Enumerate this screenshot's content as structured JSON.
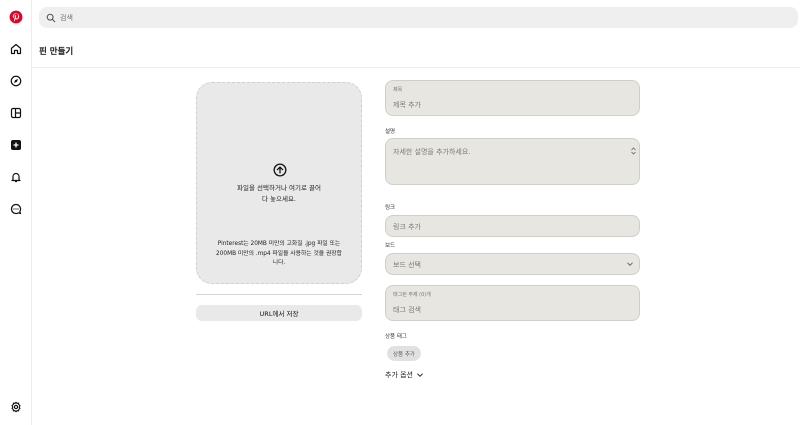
{
  "nav": {
    "items": [
      {
        "icon": "pinterest-logo-icon"
      },
      {
        "icon": "home-icon"
      },
      {
        "icon": "explore-icon"
      },
      {
        "icon": "board-icon"
      },
      {
        "icon": "create-icon"
      },
      {
        "icon": "notifications-icon"
      },
      {
        "icon": "messages-icon"
      },
      {
        "icon": "settings-icon"
      }
    ],
    "brand_color": "#E60023"
  },
  "search": {
    "placeholder": "검색"
  },
  "page": {
    "title": "핀 만들기"
  },
  "upload": {
    "main_line1": "파일을 선택하거나 여기로 끌어",
    "main_line2": "다 놓으세요.",
    "note_line1": "Pinterest는 20MB 미만의 고화질 .jpg 파일 또는",
    "note_line2": "200MB 미만의 .mp4 파일을 사용하는 것을 권장합",
    "note_line3": "니다."
  },
  "url_button": {
    "label": "URL에서 저장"
  },
  "form": {
    "title": {
      "small_label": "제목",
      "placeholder": "제목 추가"
    },
    "description": {
      "label": "설명",
      "placeholder": "자세한 설명을 추가하세요."
    },
    "link": {
      "label": "링크",
      "placeholder": "링크 추가"
    },
    "board": {
      "label": "보드",
      "value": "보드 선택"
    },
    "tags": {
      "small_label": "태그된 주제 (0)개",
      "placeholder": "태그 검색"
    },
    "product_tags": {
      "label": "상품 태그",
      "button": "상품 추가"
    },
    "more_options": "추가 옵션"
  }
}
